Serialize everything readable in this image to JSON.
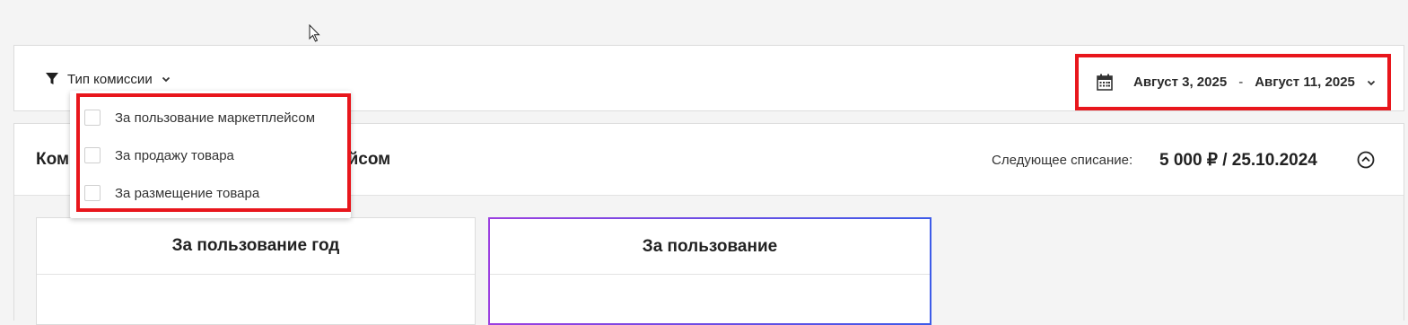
{
  "filter": {
    "label": "Тип комиссии",
    "options": [
      {
        "label": "За пользование маркетплейсом",
        "checked": false
      },
      {
        "label": "За продажу товара",
        "checked": false
      },
      {
        "label": "За размещение товара",
        "checked": false
      }
    ]
  },
  "date_range": {
    "start": "Август 3, 2025",
    "separator": "-",
    "end": "Август 11, 2025"
  },
  "card": {
    "title_left": "Ком",
    "title_right": "ейсом",
    "next_charge_label": "Следующее списание:",
    "next_charge_value": "5 000 ₽ / 25.10.2024"
  },
  "plans": [
    {
      "title": "За пользование год"
    },
    {
      "title": "За пользование"
    }
  ],
  "colors": {
    "highlight": "#e8161c",
    "plan_gradient_start": "#9b3fe0",
    "plan_gradient_end": "#3d5be8"
  },
  "icons": {
    "filter": "funnel-icon",
    "calendar": "calendar-icon",
    "chevron": "chevron-down-icon",
    "collapse": "chevron-up-circle-icon",
    "cursor": "mouse-cursor-icon"
  }
}
